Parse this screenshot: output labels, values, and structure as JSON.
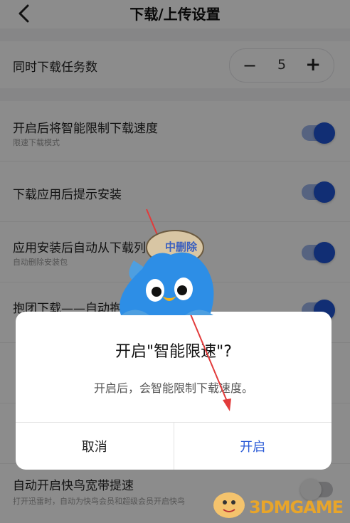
{
  "header": {
    "title": "下载/上传设置"
  },
  "concurrent": {
    "label": "同时下载任务数",
    "value": "5",
    "minus": "−",
    "plus": "+"
  },
  "settings": [
    {
      "label": "开启后将智能限制下载速度",
      "sub": "限速下载模式",
      "on": true
    },
    {
      "label": "下载应用后提示安装",
      "sub": "",
      "on": true
    },
    {
      "label": "应用安装后自动从下载列表中删除",
      "sub": "自动删除安装包",
      "on": true
    },
    {
      "label": "抱团下载——自动抱团",
      "sub": "",
      "on": true
    },
    {
      "label": "自动开启快鸟宽带提速",
      "sub": "打开迅雷时，自动为快鸟会员和超级会员开启快鸟",
      "on": false
    }
  ],
  "dialog": {
    "title": "开启\"智能限速\"?",
    "message": "开启后，会智能限制下载速度。",
    "cancel": "取消",
    "confirm": "开启"
  },
  "watermarks": {
    "stamp": "中删除",
    "brand": "3DMGAME"
  },
  "colors": {
    "accent": "#2a5bd7",
    "toggle_on": "#1f55d4"
  }
}
